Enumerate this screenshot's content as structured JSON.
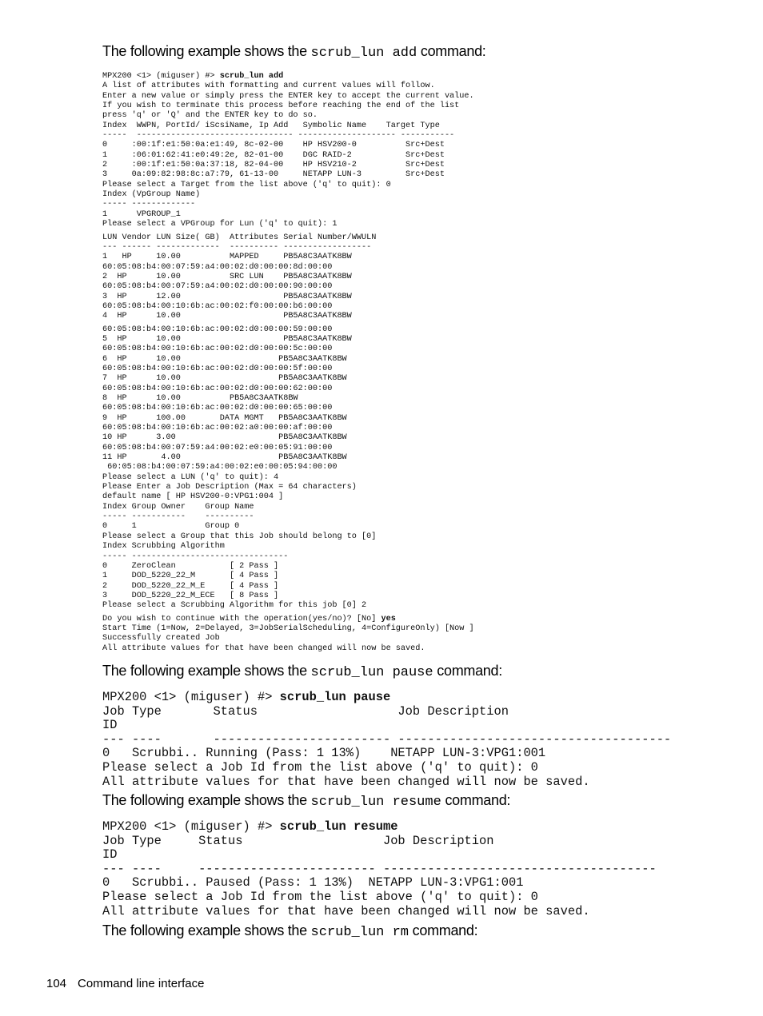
{
  "intros": {
    "add": {
      "before": "The following example shows the ",
      "code": "scrub_lun add",
      "after": " command:"
    },
    "pause": {
      "before": "The following example shows the ",
      "code": "scrub_lun pause",
      "after": " command:"
    },
    "resume": {
      "before": "The following example shows the ",
      "code": "scrub_lun resume",
      "after": " command:"
    },
    "rm": {
      "before": "The following example shows the ",
      "code": "scrub_lun rm",
      "after": " command:"
    }
  },
  "add_block": {
    "prompt": "MPX200 <1> (miguser) #> ",
    "command": "scrub_lun add",
    "lines_a": [
      "A list of attributes with formatting and current values will follow.",
      "Enter a new value or simply press the ENTER key to accept the current value.",
      "If you wish to terminate this process before reaching the end of the list",
      "press 'q' or 'Q' and the ENTER key to do so.",
      "Index  WWPN, PortId/ iScsiName, Ip Add   Symbolic Name    Target Type",
      "-----  -------------------------------- -------------------- -----------",
      "0     :00:1f:e1:50:0a:e1:49, 8c-02-00    HP HSV200-0          Src+Dest",
      "1     :06:01:62:41:e0:49:2e, 82-01-00    DGC RAID-2           Src+Dest",
      "2     :00:1f:e1:50:0a:37:18, 82-04-00    HP HSV210-2          Src+Dest",
      "3     0a:09:82:98:8c:a7:79, 61-13-00     NETAPP LUN-3         Src+Dest",
      "Please select a Target from the list above ('q' to quit): 0",
      "Index (VpGroup Name)",
      "----- -------------",
      "1      VPGROUP_1",
      "Please select a VPGroup for Lun ('q' to quit): 1"
    ],
    "lines_b": [
      "LUN Vendor LUN Size( GB)  Attributes Serial Number/WWULN",
      "--- ------ -------------  ---------- ------------------",
      "1   HP     10.00          MAPPED     PB5A8C3AATK8BW",
      "60:05:08:b4:00:07:59:a4:00:02:d0:00:00:8d:00:00",
      "2  HP      10.00          SRC LUN    PB5A8C3AATK8BW",
      "60:05:08:b4:00:07:59:a4:00:02:d0:00:00:90:00:00",
      "3  HP      12.00                     PB5A8C3AATK8BW",
      "60:05:08:b4:00:10:6b:ac:00:02:f0:00:00:b6:00:00",
      "4  HP      10.00                     PB5A8C3AATK8BW"
    ],
    "lines_c": [
      "60:05:08:b4:00:10:6b:ac:00:02:d0:00:00:59:00:00",
      "5  HP      10.00                     PB5A8C3AATK8BW",
      "60:05:08:b4:00:10:6b:ac:00:02:d0:00:00:5c:00:00",
      "6  HP      10.00                    PB5A8C3AATK8BW",
      "60:05:08:b4:00:10:6b:ac:00:02:d0:00:00:5f:00:00",
      "7  HP      10.00                    PB5A8C3AATK8BW",
      "60:05:08:b4:00:10:6b:ac:00:02:d0:00:00:62:00:00",
      "8  HP      10.00          PB5A8C3AATK8BW",
      "60:05:08:b4:00:10:6b:ac:00:02:d0:00:00:65:00:00",
      "9  HP      100.00       DATA MGMT   PB5A8C3AATK8BW",
      "60:05:08:b4:00:10:6b:ac:00:02:a0:00:00:af:00:00",
      "10 HP      3.00                     PB5A8C3AATK8BW",
      "60:05:08:b4:00:07:59:a4:00:02:e0:00:05:91:00:00",
      "11 HP       4.00                    PB5A8C3AATK8BW",
      " 60:05:08:b4:00:07:59:a4:00:02:e0:00:05:94:00:00",
      "Please select a LUN ('q' to quit): 4",
      "Please Enter a Job Description (Max = 64 characters)",
      "default name [ HP HSV200-0:VPG1:004 ]",
      "Index Group Owner    Group Name",
      "----- -----------    ----------",
      "0     1              Group 0",
      "Please select a Group that this Job should belong to [0]",
      "Index Scrubbing Algorithm",
      "----- --------------------------------",
      "0     ZeroClean           [ 2 Pass ]",
      "1     DOD_5220_22_M       [ 4 Pass ]",
      "2     DOD_5220_22_M_E     [ 4 Pass ]",
      "3     DOD_5220_22_M_ECE   [ 8 Pass ]",
      "Please select a Scrubbing Algorithm for this job [0] 2"
    ],
    "confirm_prefix": "Do you wish to continue with the operation(yes/no)? [No] ",
    "confirm_answer": "yes",
    "lines_d": [
      "Start Time (1=Now, 2=Delayed, 3=JobSerialScheduling, 4=ConfigureOnly) [Now ]",
      "Successfully created Job",
      "All attribute values for that have been changed will now be saved."
    ]
  },
  "pause_block": {
    "prompt": "MPX200 <1> (miguser) #> ",
    "command": "scrub_lun pause",
    "lines": [
      "Job Type       Status                   Job Description",
      "ID",
      "--- ----       ------------------------ -------------------------------------",
      "0   Scrubbi.. Running (Pass: 1 13%)    NETAPP LUN-3:VPG1:001",
      "Please select a Job Id from the list above ('q' to quit): 0",
      "All attribute values for that have been changed will now be saved."
    ]
  },
  "resume_block": {
    "prompt": "MPX200 <1> (miguser) #> ",
    "command": "scrub_lun resume",
    "lines": [
      "Job Type     Status                   Job Description",
      "ID",
      "--- ----     ------------------------ -------------------------------------",
      "0   Scrubbi.. Paused (Pass: 1 13%)  NETAPP LUN-3:VPG1:001",
      "Please select a Job Id from the list above ('q' to quit): 0",
      "All attribute values for that have been changed will now be saved."
    ]
  },
  "footer": {
    "page_number": "104",
    "section": "Command line interface"
  }
}
